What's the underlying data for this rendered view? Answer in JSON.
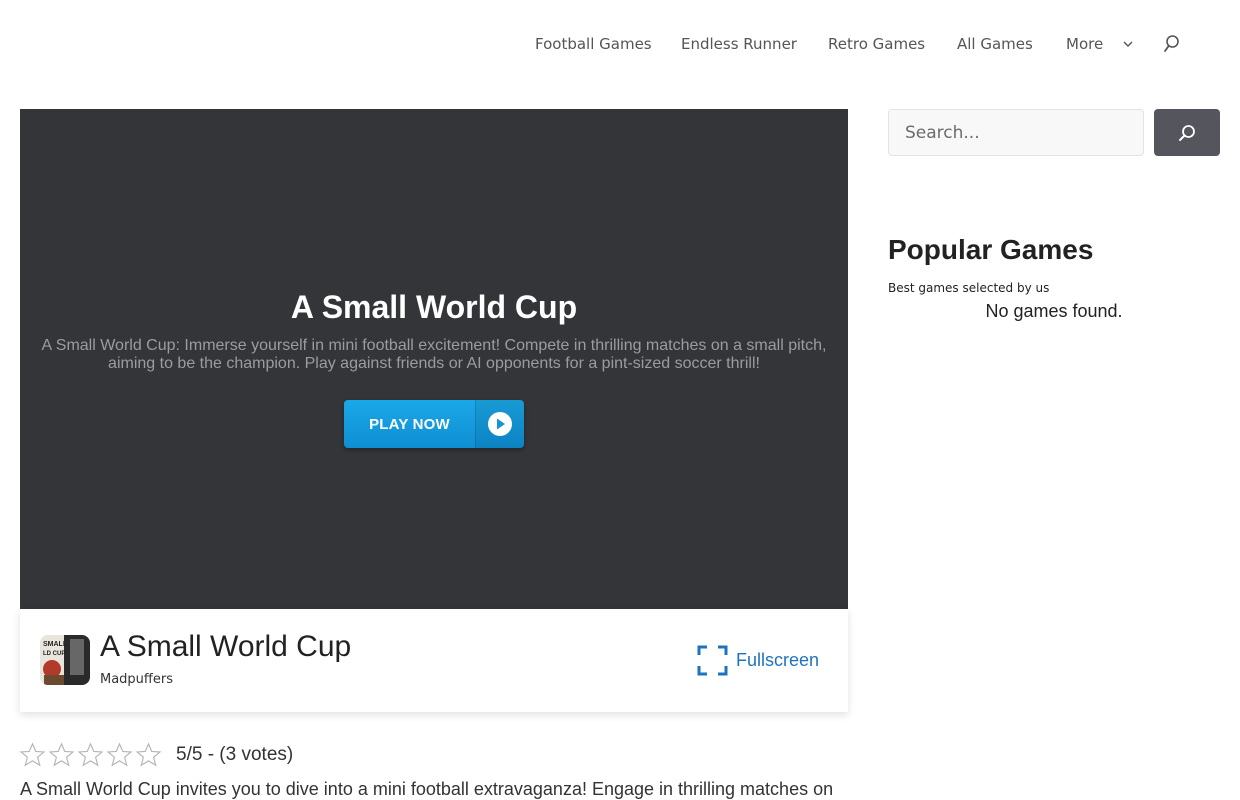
{
  "header": {
    "nav": [
      "Football Games",
      "Endless Runner",
      "Retro Games",
      "All Games"
    ],
    "more_label": "More",
    "icons": {
      "more": "chevron-down-icon",
      "search": "search-icon"
    }
  },
  "player": {
    "title": "A Small World Cup",
    "description": "A Small World Cup: Immerse yourself in mini football excitement! Compete in thrilling matches on a small pitch, aiming to be the champion. Play against friends or AI opponents for a pint-sized soccer thrill!",
    "play_label": "PLAY NOW",
    "play_icon": "play-circle-icon",
    "background_color": "#333538",
    "button_color": "#1ba8e8"
  },
  "game_info": {
    "name": "A Small World Cup",
    "developer": "Madpuffers",
    "thumbnail_text": "SMALL WORLD CUP",
    "fullscreen_label": "Fullscreen",
    "fullscreen_icon": "fullscreen-icon",
    "accent_color": "#1e73be"
  },
  "rating": {
    "stars_total": 5,
    "stars_filled": 0,
    "text": "5/5 - (3 votes)"
  },
  "body_text": "A Small World Cup invites you to dive into a mini football extravaganza! Engage in thrilling matches on",
  "sidebar": {
    "search_placeholder": "Search...",
    "search_button_icon": "search-icon",
    "widget_title": "Popular Games",
    "widget_subtitle": "Best games selected by us",
    "widget_empty": "No games found."
  }
}
